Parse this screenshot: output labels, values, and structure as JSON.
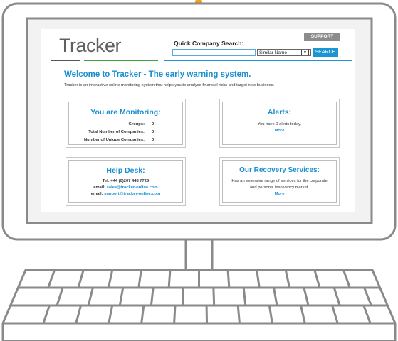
{
  "header": {
    "logo": "Tracker",
    "support_label": "SUPPORT",
    "quick_search_label": "Quick Company Search:",
    "search_value": "",
    "match_option": "Similar Name",
    "search_button": "SEARCH"
  },
  "main": {
    "welcome_title": "Welcome to Tracker - The early warning system.",
    "intro": "Tracker is an interactive online monitoring system that helps you to analyse financial risks and target new business."
  },
  "monitoring": {
    "title": "You are Monitoring:",
    "rows": [
      {
        "label": "Groups:",
        "value": "0"
      },
      {
        "label": "Total Number of Companies:",
        "value": "0"
      },
      {
        "label": "Number of Unique Companies:",
        "value": "0"
      }
    ]
  },
  "alerts": {
    "title": "Alerts:",
    "text": "You have 0 alerts today.",
    "more": "More"
  },
  "helpdesk": {
    "title": "Help Desk:",
    "tel": "Tel: +44 (0)207 448 7725",
    "email_label": "email:",
    "email1": "sales@tracker-online.com",
    "email2": "support@tracker-online.com"
  },
  "recovery": {
    "title": "Our Recovery Services:",
    "line1": "Has an extensive range of services for the corporate",
    "line2": "and personal insolvency market.",
    "more": "More"
  },
  "colors": {
    "accent_blue": "#1b8fd0",
    "logo_underline_dark": "#555555",
    "logo_underline_green": "#3aa33a",
    "frame_gray": "#8a8a8a",
    "webcam_orange": "#f0a020"
  }
}
